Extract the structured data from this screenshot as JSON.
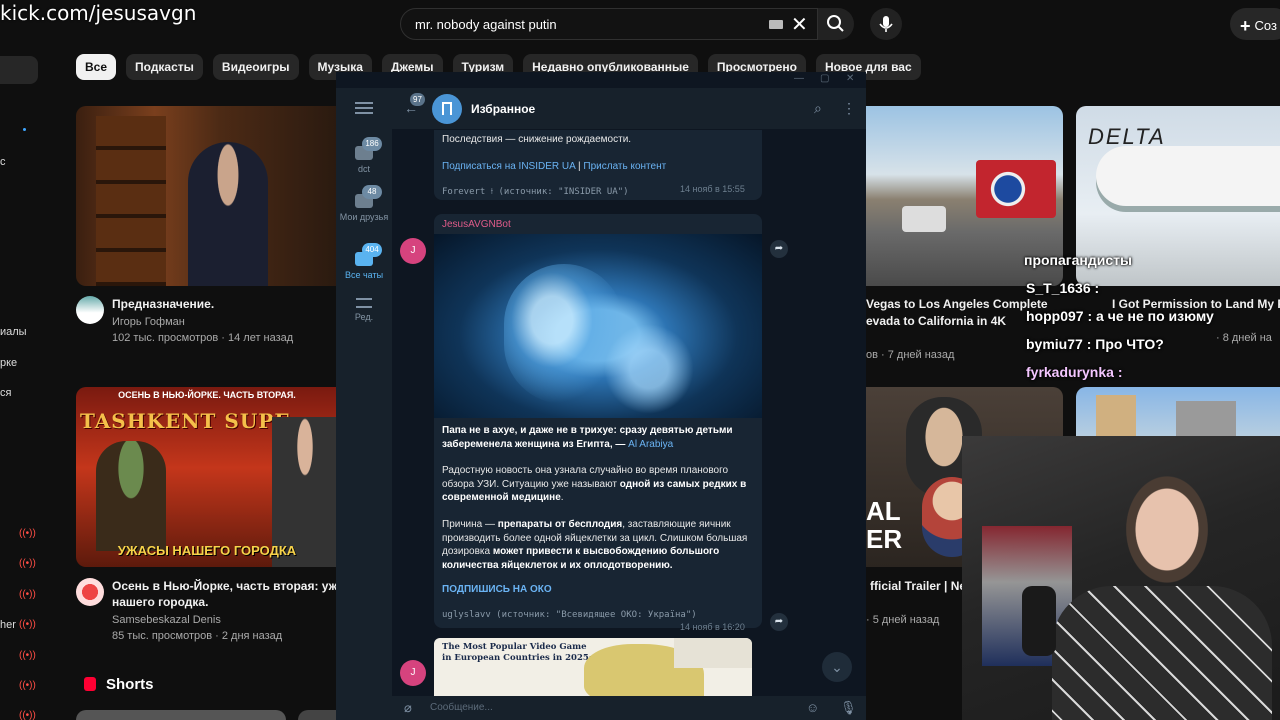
{
  "stream_url": "kick.com/jesusavgn",
  "youtube": {
    "search_value": "mr. nobody against putin",
    "create_label": "Соз",
    "chips": [
      "Все",
      "Подкасты",
      "Видеоигры",
      "Музыка",
      "Джемы",
      "Туризм",
      "Недавно опубликованные",
      "Просмотрено",
      "Новое для вас"
    ],
    "sidebar_fragments": [
      "с",
      "иалы",
      "рке",
      "ся",
      "her"
    ],
    "videos": [
      {
        "title": "Предназначение.",
        "channel": "Игорь Гофман",
        "meta": "102 тыс. просмотров · 14 лет назад"
      },
      {
        "thumb_caption_top": "ОСЕНЬ В НЬЮ-ЙОРКЕ. ЧАСТЬ ВТОРАЯ.",
        "thumb_caption_main": "TASHKENT SUPE",
        "thumb_caption_bottom": "УЖАСЫ НАШЕГО ГОРОДКА",
        "title_line1": "Осень в Нью-Йорке, часть вторая: ужас",
        "title_line2": "нашего городка.",
        "channel": "Samsebeskazal Denis",
        "meta": "85 тыс. просмотров · 2 дня назад"
      },
      {
        "title_line1": "Vegas to Los Angeles Complete",
        "title_line2": "evada to California in 4K",
        "meta": "ов · 7 дней назад"
      },
      {
        "thumb_text": "DELTA",
        "title": "I Got Permission to Land My Pl",
        "meta": "· 8 дней на"
      },
      {
        "thumb_text_1": "AL",
        "thumb_text_2": "ER",
        "title": "fficial Trailer | Net",
        "meta": "· 5 дней назад"
      }
    ],
    "shorts_label": "Shorts"
  },
  "stream_chat": [
    {
      "text": "пропагандисты"
    },
    {
      "user": "S_T_1636 :",
      "text": ""
    },
    {
      "user": "hopp097 :",
      "text": "а че не по изюму"
    },
    {
      "user": "bymiu77 :",
      "text": "Про ЧТО?"
    },
    {
      "user": "fyrkadurynka :",
      "text": ""
    }
  ],
  "telegram": {
    "chat_title": "Избранное",
    "back_badge": "97",
    "rail": [
      {
        "label": "dct",
        "badge": "186"
      },
      {
        "label": "Мои друзья",
        "badge": "48"
      },
      {
        "label": "Все чаты",
        "badge": "404"
      },
      {
        "label": "Ред.",
        "badge": ""
      }
    ],
    "msg1": {
      "text": "Последствия — снижение рождаемости.",
      "link1": "Подписаться на INSIDER UA",
      "sep": "|",
      "link2": "Прислать контент",
      "forward": "Forevert ⟊ (источник: \"INSIDER UA\")",
      "time": "14 нояб в 15:55",
      "avatar": "J"
    },
    "msg2": {
      "sender": "JesusAVGNBot",
      "para1_bold": "Папа не в ахуе, и даже не в трихуе: сразу девятью детьми забеременела женщина из Египта, —",
      "para1_link": "Al Arabiya",
      "para2_a": "Радостную новость она узнала случайно во время планового обзора УЗИ. Ситуацию уже называют",
      "para2_b": "одной из самых редких в современной медицине",
      "para3_a": "Причина —",
      "para3_b": "препараты от бесплодия",
      "para3_c": ", заставляющие яичник производить более одной яйцеклетки за цикл. Слишком большая дозировка",
      "para3_d": "может привести к высвобождению большого количества яйцеклеток и их оплодотворению.",
      "cta": "ПОДПИШИСЬ НА ОКО",
      "forward": "uglyslavv (источник: \"Всевидящее ОКО: Україна\")",
      "time": "14 нояб в 16:20",
      "avatar": "J"
    },
    "msg3": {
      "image_title_line1": "The Most Popular Video Game",
      "image_title_line2": "in European Countries in 2025:",
      "avatar": "J"
    },
    "input_placeholder": "Сообщение..."
  },
  "colors": {
    "yt_bg": "#0f0f0f",
    "tg_bg": "#0e1621",
    "tg_panel": "#17212b",
    "tg_bubble": "#182533",
    "tg_link": "#6ab3f3",
    "tg_accent": "#5ab3f0",
    "bot_name": "#e05b8a"
  }
}
